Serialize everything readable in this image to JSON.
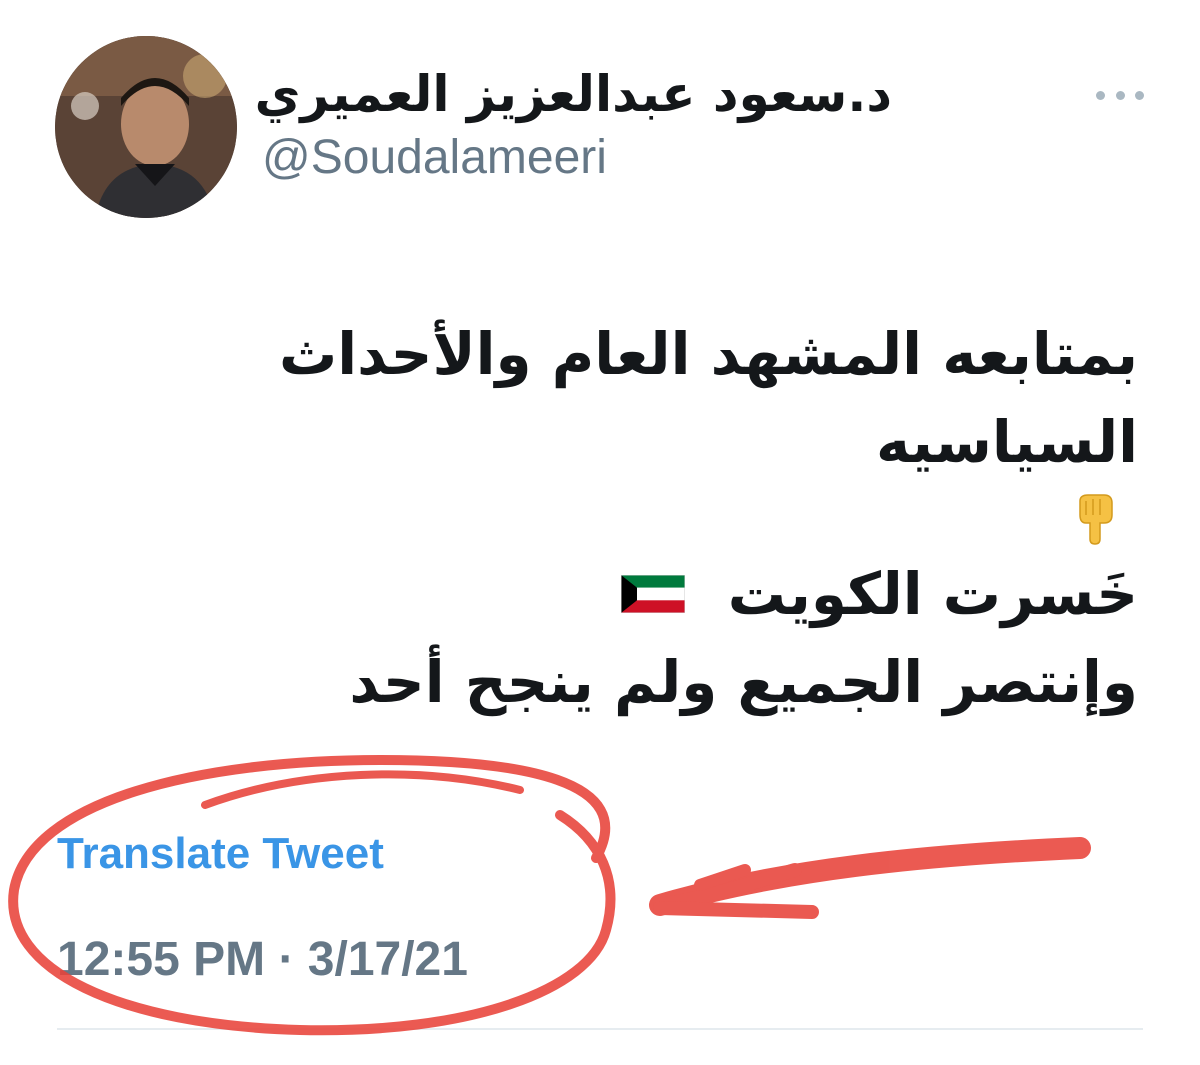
{
  "author": {
    "name": "د.سعود عبدالعزيز العميري",
    "handle": "@Soudalameeri"
  },
  "tweet": {
    "line1": "بمتابعه المشهد العام والأحداث",
    "line2": "السياسيه",
    "emoji": "point-down-hand",
    "line4": "خَسرت الكويت",
    "line4_flag": "kuwait-flag",
    "line5": "وإنتصر الجميع ولم ينجح أحد"
  },
  "translate_label": "Translate Tweet",
  "timestamp": {
    "time": "12:55 PM",
    "separator": "·",
    "date": "3/17/21"
  },
  "colors": {
    "link": "#3a95e6",
    "muted": "#657786",
    "text": "#14171a",
    "annotation": "#e8433a"
  }
}
